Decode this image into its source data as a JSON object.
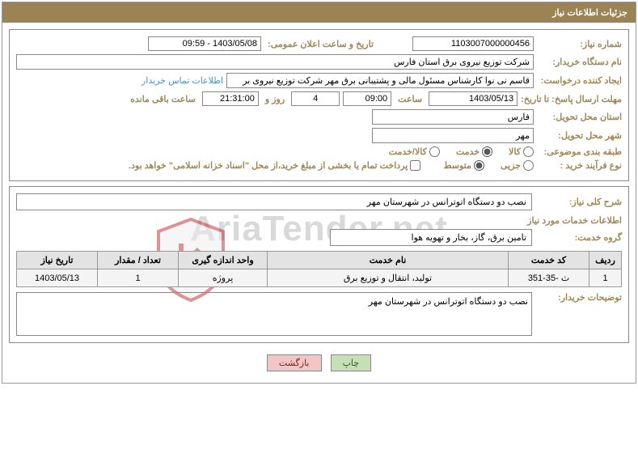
{
  "header": {
    "title": "جزئیات اطلاعات نیاز"
  },
  "box1": {
    "need_number_label": "شماره نیاز:",
    "need_number": "1103007000000456",
    "announce_label": "تاریخ و ساعت اعلان عمومی:",
    "announce_value": "1403/05/08 - 09:59",
    "buyer_label": "نام دستگاه خریدار:",
    "buyer_value": "شرکت توزیع نیروی برق استان فارس",
    "creator_label": "ایجاد کننده درخواست:",
    "creator_value": "قاسم نی نوا کارشناس مسئول مالی و پشتیبانی برق مهر شرکت توزیع نیروی بر",
    "contact_link": "اطلاعات تماس خریدار",
    "deadline_label": "مهلت ارسال پاسخ: تا تاریخ:",
    "deadline_date": "1403/05/13",
    "time_label": "ساعت",
    "deadline_time": "09:00",
    "days_value": "4",
    "days_and": "روز و",
    "remain_time": "21:31:00",
    "remain_label": "ساعت باقی مانده",
    "province_label": "استان محل تحویل:",
    "province_value": "فارس",
    "city_label": "شهر محل تحویل:",
    "city_value": "مهر",
    "category_label": "طبقه بندی موضوعی:",
    "cat_goods": "کالا",
    "cat_service": "خدمت",
    "cat_both": "کالا/خدمت",
    "process_label": "نوع فرآیند خرید :",
    "proc_partial": "جزیی",
    "proc_medium": "متوسط",
    "payment_note": "پرداخت تمام یا بخشی از مبلغ خرید،از محل \"اسناد خزانه اسلامی\" خواهد بود."
  },
  "box2": {
    "desc_label": "شرح کلی نیاز:",
    "desc_value": "نصب دو دستگاه اتوترانس در شهرستان مهر",
    "services_header": "اطلاعات خدمات مورد نیاز",
    "group_label": "گروه خدمت:",
    "group_value": "تامین برق، گاز، بخار و تهویه هوا",
    "table": {
      "headers": {
        "row": "ردیف",
        "code": "کد خدمت",
        "name": "نام خدمت",
        "unit": "واحد اندازه گیری",
        "qty": "تعداد / مقدار",
        "date": "تاریخ نیاز"
      },
      "rows": [
        {
          "row": "1",
          "code": "ث -35-351",
          "name": "تولید، انتقال و توزیع برق",
          "unit": "پروژه",
          "qty": "1",
          "date": "1403/05/13"
        }
      ]
    },
    "buyer_notes_label": "توضیحات خریدار:",
    "buyer_notes_value": "نصب دو دستگاه اتوترانس در شهرستان مهر"
  },
  "buttons": {
    "print": "چاپ",
    "back": "بازگشت"
  },
  "watermark": {
    "text": "AriaTender.net"
  }
}
